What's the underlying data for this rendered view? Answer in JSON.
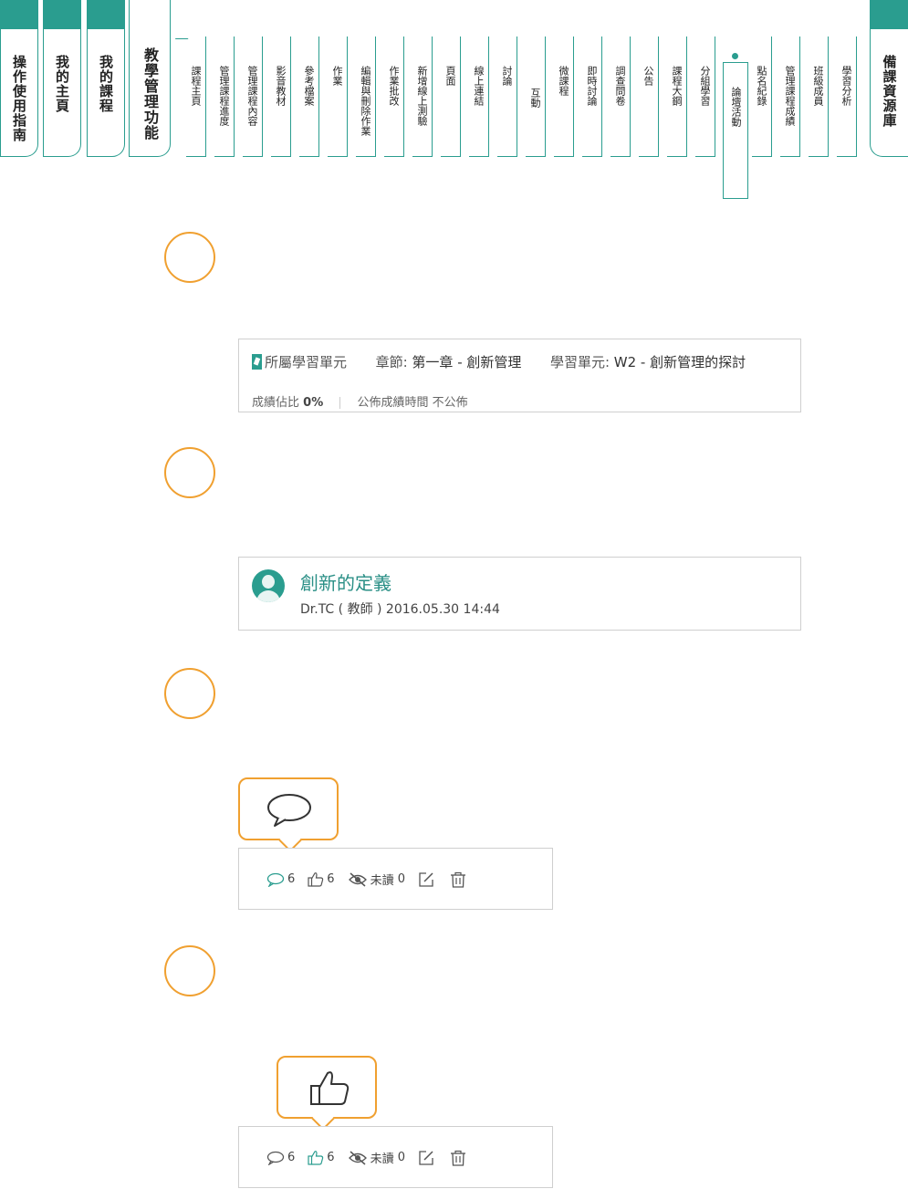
{
  "nav": {
    "major_tabs": [
      {
        "label": "操作使用指南"
      },
      {
        "label": "我的主頁"
      },
      {
        "label": "我的課程"
      },
      {
        "label": "教學管理功能"
      },
      {
        "label": "備課資源庫"
      }
    ],
    "sub_tabs": [
      {
        "label": "課程主頁"
      },
      {
        "label": "管理課程進度"
      },
      {
        "label": "管理課程內容"
      },
      {
        "label": "影音教材"
      },
      {
        "label": "參考檔案"
      },
      {
        "label": "作業"
      },
      {
        "label": "編輯與刪除作業"
      },
      {
        "label": "作業批改"
      },
      {
        "label": "新增線上測驗"
      },
      {
        "label": "頁面"
      },
      {
        "label": "線上連結"
      },
      {
        "label": "討論"
      },
      {
        "label": "互動"
      },
      {
        "label": "微課程"
      },
      {
        "label": "即時討論"
      },
      {
        "label": "調查問卷"
      },
      {
        "label": "公告"
      },
      {
        "label": "課程大鋼"
      },
      {
        "label": "分組學習"
      },
      {
        "label": "論壇活動"
      },
      {
        "label": "點名紀錄"
      },
      {
        "label": "管理課程成績"
      },
      {
        "label": "班級成員"
      },
      {
        "label": "學習分析"
      }
    ],
    "active_sub_tab": "論壇活動"
  },
  "unit_info": {
    "unit_label": "所屬學習單元",
    "chapter_key": "章節:",
    "chapter_value": "第一章 - 創新管理",
    "unit_key": "學習單元:",
    "unit_value": "W2 - 創新管理的探討",
    "score_ratio_key": "成績佔比",
    "score_ratio_value": "0%",
    "publish_time_key": "公佈成績時間",
    "publish_time_value": "不公佈"
  },
  "post": {
    "title": "創新的定義",
    "meta": "Dr.TC ( 教師 ) 2016.05.30 14:44"
  },
  "actions_1": {
    "comments": "6",
    "likes": "6",
    "unread_label": "未讀",
    "unread_count": "0"
  },
  "actions_2": {
    "comments": "6",
    "likes": "6",
    "unread_label": "未讀",
    "unread_count": "0"
  },
  "colors": {
    "accent": "#2a9d8f",
    "highlight": "#f0a030"
  }
}
